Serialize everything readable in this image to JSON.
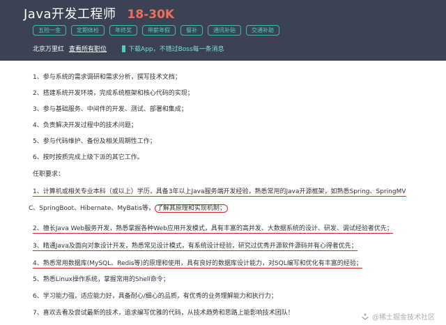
{
  "header": {
    "job_title": "Java开发工程师",
    "salary": "18-30K",
    "tags": [
      "五险一金",
      "定期体检",
      "年终奖",
      "带薪年假",
      "餐补",
      "通讯补贴",
      "交通补助"
    ],
    "company": "北京万里红",
    "all_jobs_link": "查看所有职位",
    "app_promo": "下载App，不错过Boss每一条消息"
  },
  "responsibilities": [
    "1、参与系统的需求调研和需求分析，撰写技术文档；",
    "2、搭建系统开发环境，完成系统框架和核心代码的实现；",
    "3、参与基础服务、中间件的开发、测试、部署和集成；",
    "4、负责解决开发过程中的技术问题；",
    "5、参与代码维护、备份及相关周期性工作；",
    "6、按时按质完成上级下派的其它工作。"
  ],
  "requirements_heading": "任职要求：",
  "requirements": {
    "r1_line1": "1、计算机或相关专业本科（或以上）学历，具备3年以上Java服务端开发经验，熟悉常用的Java开源框架，如熟悉Spring、SpringMV",
    "r1_line2a": "C、SpringBoot、Hibernate、MyBatis等，",
    "r1_line2b": "了解其原理和实现机制；",
    "r2": "2、擅长Java Web服务开发，熟悉掌握各种Web应用开发模式，具有丰富的高并发、大数据系统的设计、研发、调试经验者优先；",
    "r3": "3、精通Java及面向对象设计开发，熟悉常见设计模式，有系统设计经验，研究过优秀开源软件源码并有心得者优先；",
    "r4": "4、熟悉常用数据库(MySQL、Redis等)的原理和使用，具有良好的数据库设计能力，对SQL编写和优化有丰富的经验；",
    "r5": "5、熟悉Linux操作系统，掌握常用的Shell命令；",
    "r6": "6、学习能力强，适应能力好，具备耐心/细心的品质，有优秀的业务理解能力和执行力；",
    "r7": "7、喜欢去看及尝试最新的技术，追求编写优雅的代码，从技术趋势和思路上能影响技术团队！"
  },
  "watermark": "@稀土掘金技术社区",
  "colors": {
    "header_bg": "#3a4254",
    "salary": "#f26d5b",
    "tag_border": "#4db6ac",
    "annotation_red": "#d42828"
  }
}
